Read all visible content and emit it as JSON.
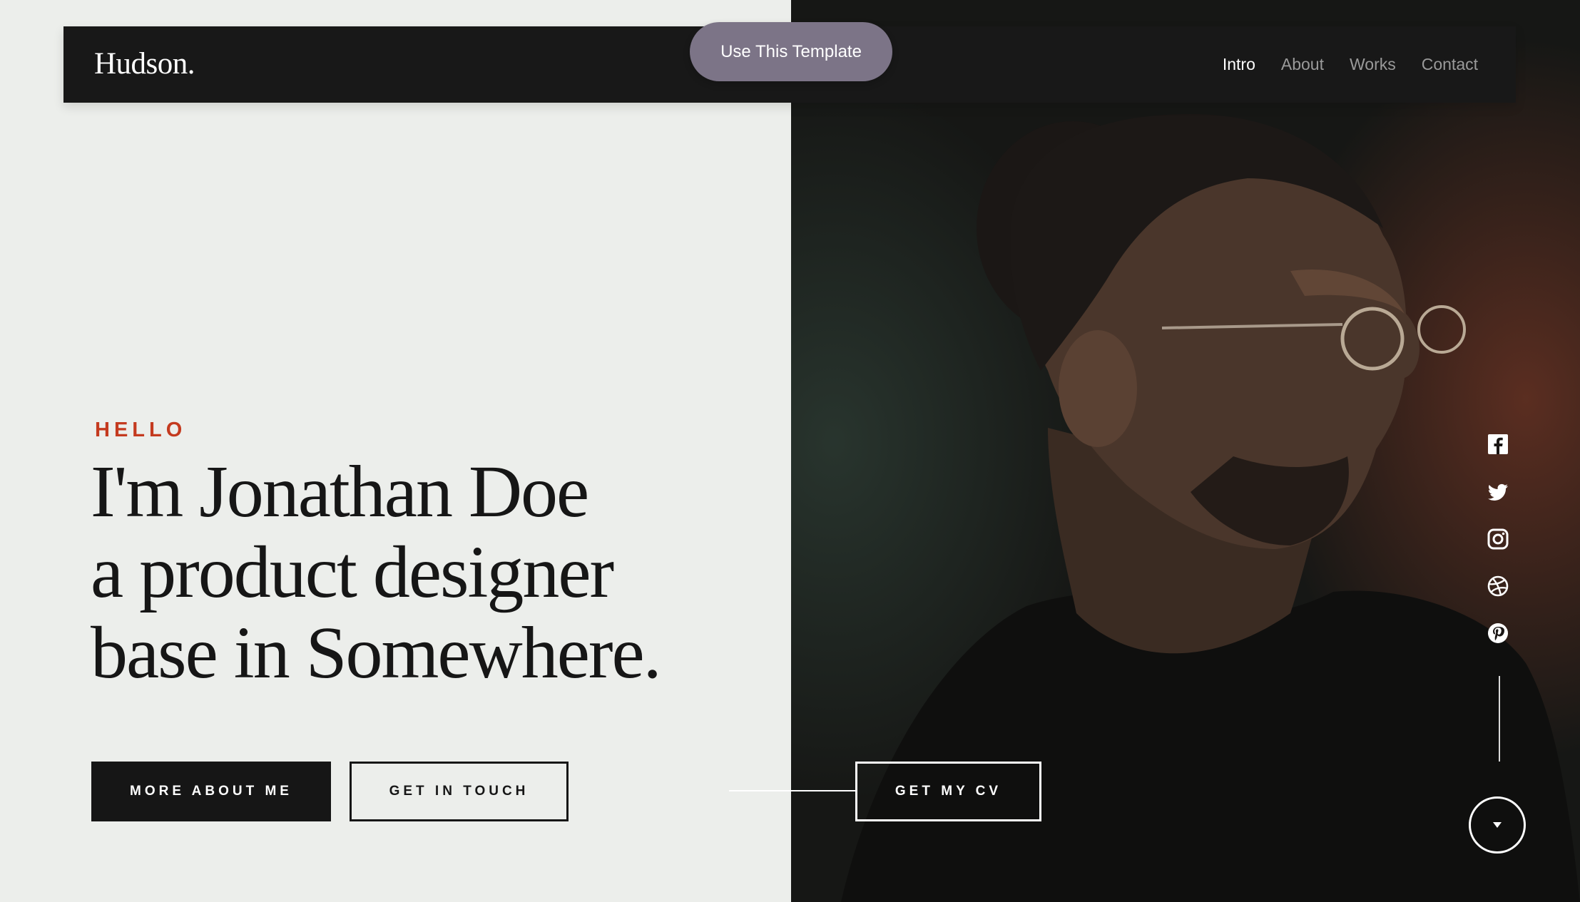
{
  "header": {
    "logo": "Hudson.",
    "nav": [
      {
        "label": "Intro",
        "active": true
      },
      {
        "label": "About",
        "active": false
      },
      {
        "label": "Works",
        "active": false
      },
      {
        "label": "Contact",
        "active": false
      }
    ]
  },
  "template_button": {
    "label": "Use This Template"
  },
  "hero": {
    "eyebrow": "HELLO",
    "headline_lines": [
      "I'm Jonathan Doe",
      "a product designer",
      "base in Somewhere."
    ],
    "buttons": {
      "more": "MORE ABOUT ME",
      "touch": "GET IN TOUCH",
      "cv": "GET MY CV"
    }
  },
  "social": {
    "icons": [
      "facebook-icon",
      "twitter-icon",
      "instagram-icon",
      "dribbble-icon",
      "pinterest-icon"
    ]
  },
  "scroll": {
    "icon": "chevron-down-icon"
  },
  "colors": {
    "accent": "#c43a1f",
    "dark": "#161616",
    "template_button": "#7c7487",
    "background": "#eceeeb"
  }
}
